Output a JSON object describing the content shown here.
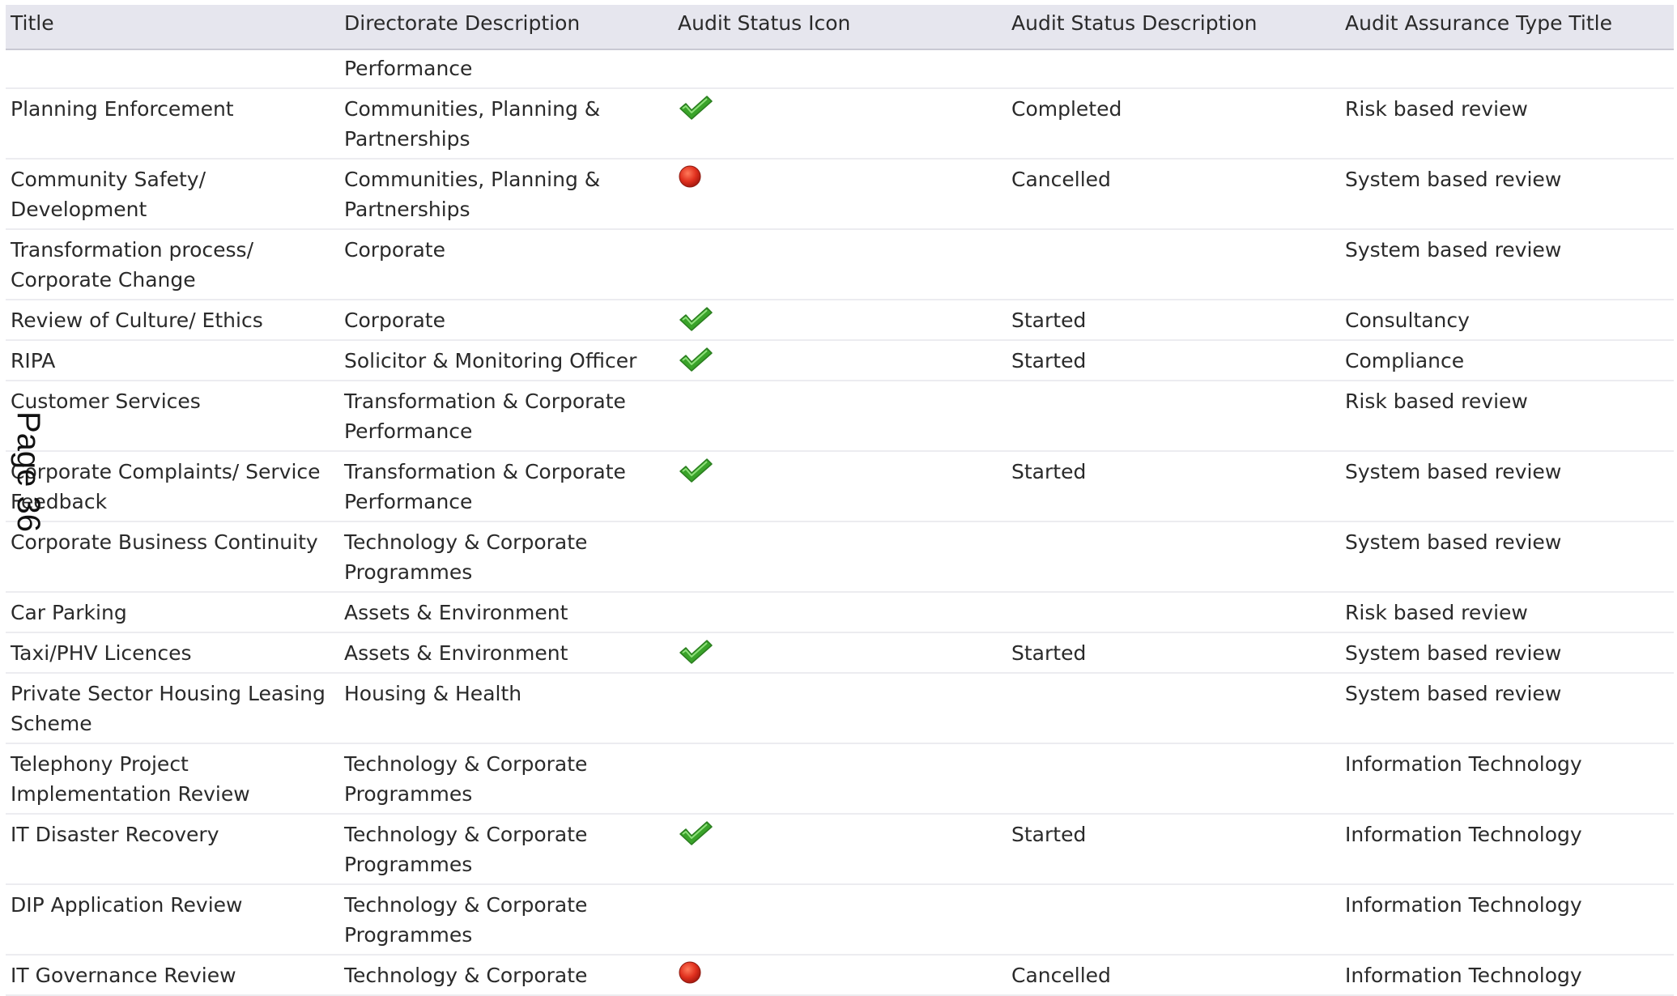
{
  "columns": {
    "title": "Title",
    "directorate": "Directorate Description",
    "status_icon": "Audit Status Icon",
    "status": "Audit Status Description",
    "assurance": "Audit Assurance Type Title"
  },
  "rows": [
    {
      "title": "",
      "directorate": "Performance",
      "icon": "none",
      "status": "",
      "assurance": ""
    },
    {
      "title": "Planning Enforcement",
      "directorate": "Communities, Planning & Partnerships",
      "icon": "green-check",
      "status": "Completed",
      "assurance": "Risk based review"
    },
    {
      "title": "Community Safety/ Development",
      "directorate": "Communities, Planning & Partnerships",
      "icon": "red-dot",
      "status": "Cancelled",
      "assurance": "System based review"
    },
    {
      "title": "Transformation process/ Corporate Change",
      "directorate": "Corporate",
      "icon": "none",
      "status": "",
      "assurance": "System based review"
    },
    {
      "title": "Review of Culture/ Ethics",
      "directorate": "Corporate",
      "icon": "green-check",
      "status": "Started",
      "assurance": "Consultancy"
    },
    {
      "title": "RIPA",
      "directorate": "Solicitor & Monitoring Officer",
      "icon": "green-check",
      "status": "Started",
      "assurance": "Compliance"
    },
    {
      "title": "Customer Services",
      "directorate": "Transformation & Corporate Performance",
      "icon": "none",
      "status": "",
      "assurance": "Risk based review"
    },
    {
      "title": "Corporate Complaints/ Service Feedback",
      "directorate": "Transformation & Corporate Performance",
      "icon": "green-check",
      "status": "Started",
      "assurance": "System based review"
    },
    {
      "title": "Corporate Business Continuity",
      "directorate": "Technology & Corporate Programmes",
      "icon": "none",
      "status": "",
      "assurance": "System based review"
    },
    {
      "title": "Car Parking",
      "directorate": "Assets & Environment",
      "icon": "none",
      "status": "",
      "assurance": "Risk based review"
    },
    {
      "title": "Taxi/PHV Licences",
      "directorate": "Assets & Environment",
      "icon": "green-check",
      "status": "Started",
      "assurance": "System based review"
    },
    {
      "title": "Private Sector Housing Leasing Scheme",
      "directorate": "Housing & Health",
      "icon": "none",
      "status": "",
      "assurance": "System based review"
    },
    {
      "title": "Telephony Project Implementation Review",
      "directorate": "Technology & Corporate Programmes",
      "icon": "none",
      "status": "",
      "assurance": "Information Technology"
    },
    {
      "title": "IT Disaster Recovery",
      "directorate": "Technology & Corporate Programmes",
      "icon": "green-check",
      "status": "Started",
      "assurance": "Information Technology"
    },
    {
      "title": "DIP Application Review",
      "directorate": "Technology & Corporate Programmes",
      "icon": "none",
      "status": "",
      "assurance": "Information Technology"
    },
    {
      "title": "IT Governance Review",
      "directorate": "Technology & Corporate",
      "icon": "red-dot",
      "status": "Cancelled",
      "assurance": "Information Technology"
    }
  ],
  "page_label": "Page 36",
  "colors": {
    "check_green": "#3aa32a",
    "dot_red": "#e0301e",
    "header_bg": "#e6e6ee"
  }
}
